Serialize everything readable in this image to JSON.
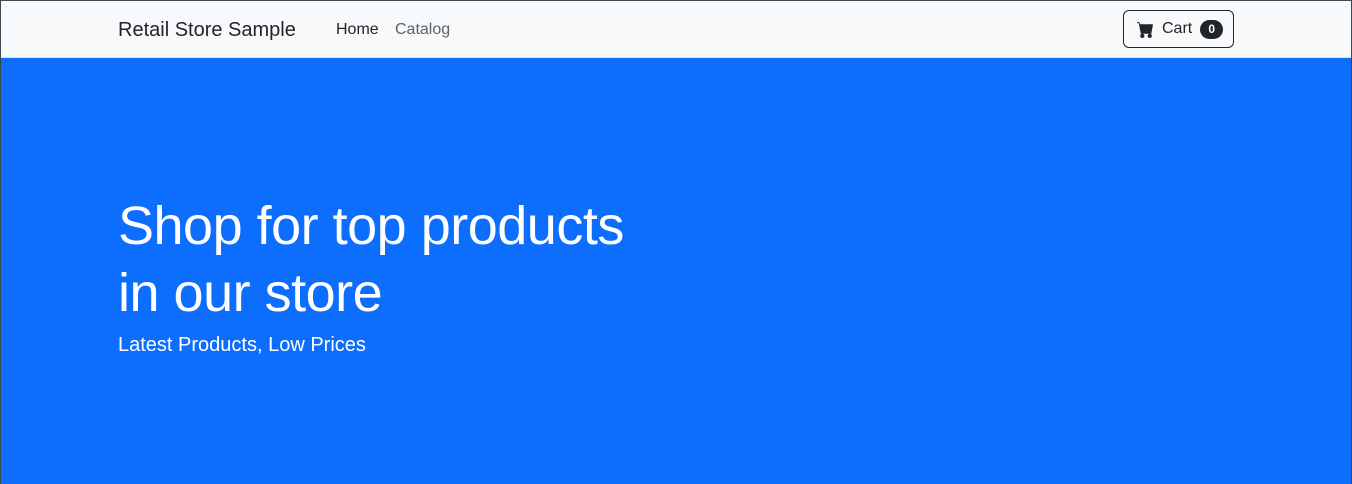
{
  "navbar": {
    "brand": "Retail Store Sample",
    "links": [
      {
        "label": "Home"
      },
      {
        "label": "Catalog"
      }
    ],
    "cart": {
      "label": "Cart",
      "count": "0",
      "icon": "cart-icon"
    }
  },
  "hero": {
    "title": "Shop for top products in our store",
    "subtitle": "Latest Products, Low Prices",
    "background_color": "#0d6efd"
  }
}
